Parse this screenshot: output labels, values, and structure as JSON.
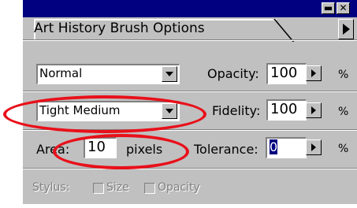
{
  "palette": {
    "title": "Art History Brush Options",
    "title_bar_color": "#000080",
    "face_color": "#c0c0c0",
    "annotation_color": "#e8101a",
    "minimize_icon": "minimize-icon",
    "close_icon": "close-icon",
    "menu_icon": "flyout-menu-arrow-icon"
  },
  "row1": {
    "mode_value": "Normal",
    "opacity_label": "Opacity:",
    "opacity_value": "100",
    "percent": "%"
  },
  "row2": {
    "style_value": "Tight Medium",
    "fidelity_label": "Fidelity:",
    "fidelity_value": "100",
    "percent": "%"
  },
  "row3": {
    "area_label": "Area:",
    "area_value": "10",
    "area_unit": "pixels",
    "tolerance_label": "Tolerance:",
    "tolerance_value": "0",
    "percent": "%"
  },
  "row4": {
    "stylus_label": "Stylus:",
    "size_label": "Size",
    "opacity_label": "Opacity"
  }
}
